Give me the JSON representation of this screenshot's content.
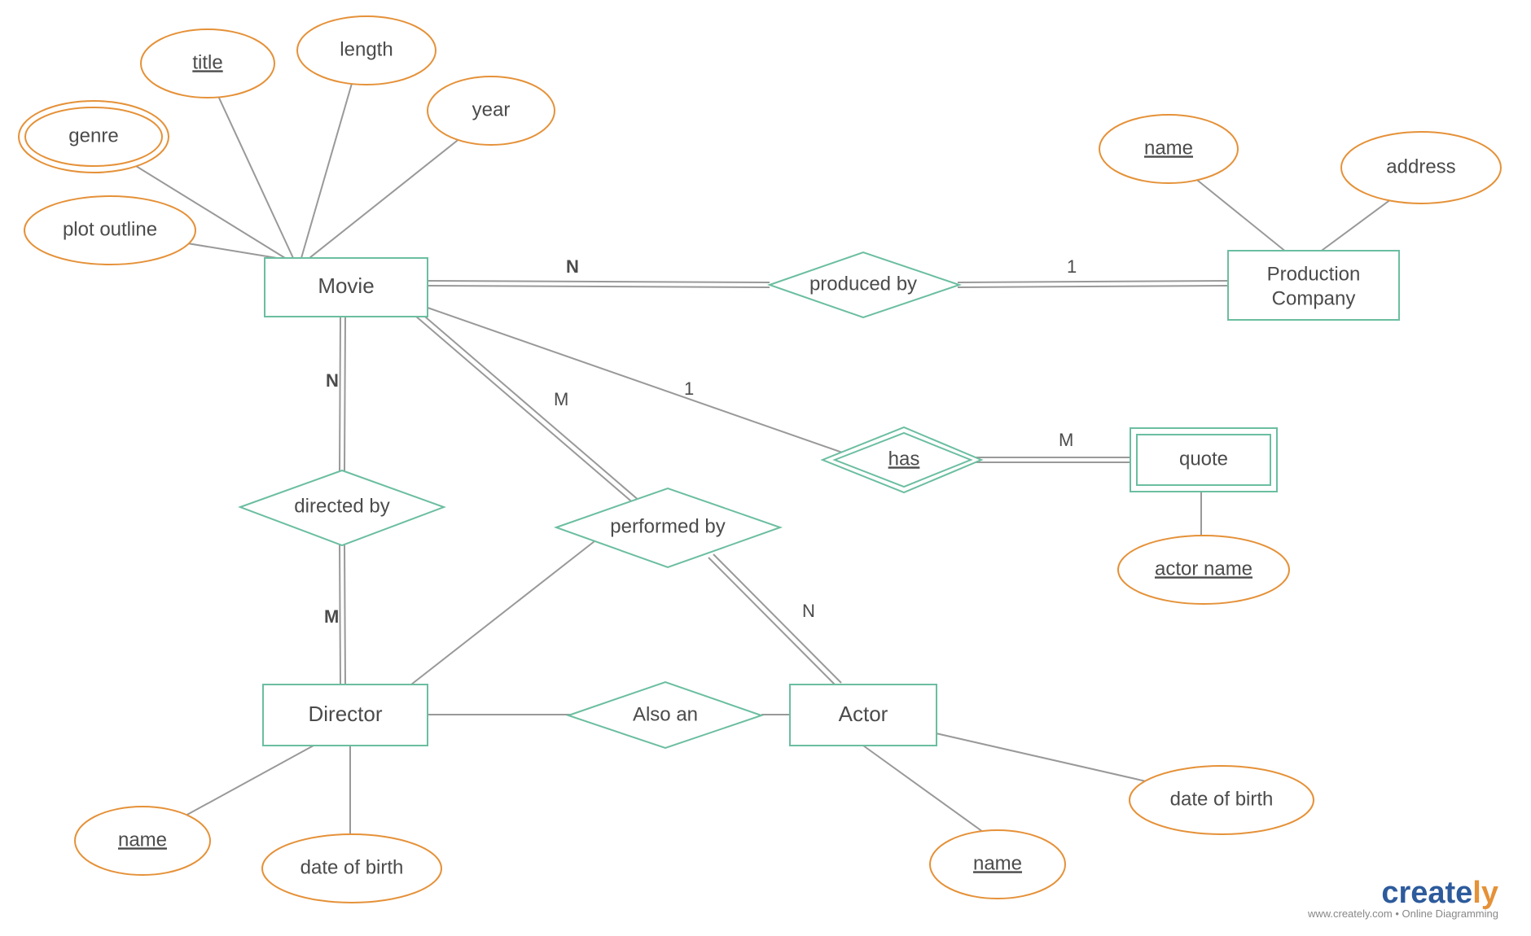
{
  "entities": {
    "movie": "Movie",
    "production_company_l1": "Production",
    "production_company_l2": "Company",
    "director": "Director",
    "actor": "Actor",
    "quote": "quote"
  },
  "relationships": {
    "produced_by": "produced by",
    "directed_by": "directed by",
    "performed_by": "performed by",
    "also_an": "Also an",
    "has": "has"
  },
  "attributes": {
    "genre": "genre",
    "title": "title",
    "length": "length",
    "year": "year",
    "plot_outline": "plot outline",
    "prod_name": "name",
    "prod_address": "address",
    "actor_name_quote": "actor name",
    "director_name": "name",
    "director_dob": "date of birth",
    "actor_name": "name",
    "actor_dob": "date of birth"
  },
  "cardinalities": {
    "movie_produced": "N",
    "prod_produced": "1",
    "movie_directed": "N",
    "director_directed": "M",
    "movie_performed": "M",
    "actor_performed": "N",
    "movie_has": "1",
    "quote_has": "M"
  },
  "logo": {
    "name": "creately",
    "sub": "www.creately.com • Online Diagramming"
  },
  "colors": {
    "entity_stroke": "#6bbea0",
    "attribute_stroke": "#e59138",
    "edge": "#999999",
    "text": "#4b4b4b"
  }
}
